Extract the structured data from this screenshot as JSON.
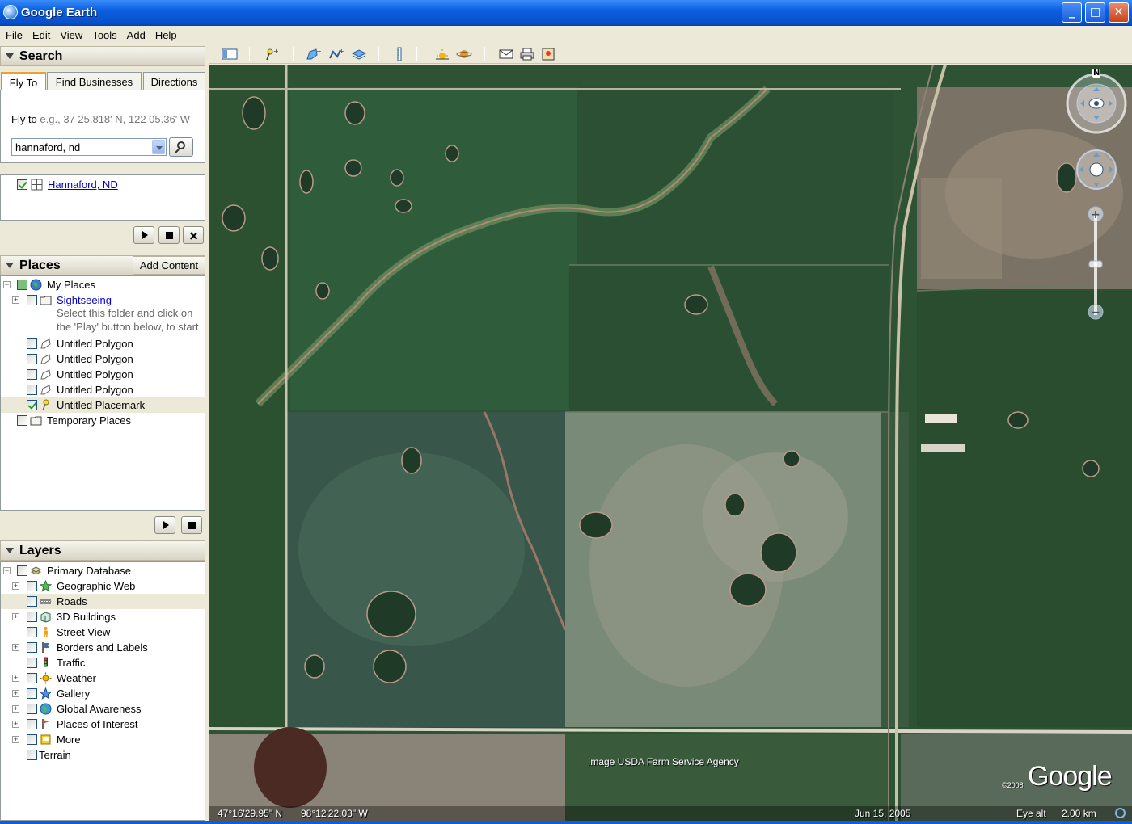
{
  "window": {
    "title": "Google Earth",
    "min": "_",
    "max": "□",
    "close": "✕"
  },
  "menu": [
    "File",
    "Edit",
    "View",
    "Tools",
    "Add",
    "Help"
  ],
  "search": {
    "header": "Search",
    "tabs": [
      "Fly To",
      "Find Businesses",
      "Directions"
    ],
    "fly_label": "Fly to",
    "fly_hint": "e.g., 37 25.818' N, 122 05.36' W",
    "query": "hannaford, nd",
    "result": "Hannaford, ND"
  },
  "places": {
    "header": "Places",
    "add_content": "Add Content",
    "items": [
      {
        "label": "My Places"
      },
      {
        "label": "Sightseeing"
      },
      {
        "label": "Select this folder and click on"
      },
      {
        "label": "the 'Play' button below, to start"
      },
      {
        "label": "Untitled Polygon"
      },
      {
        "label": "Untitled Polygon"
      },
      {
        "label": "Untitled Polygon"
      },
      {
        "label": "Untitled Polygon"
      },
      {
        "label": "Untitled Placemark"
      },
      {
        "label": "Temporary Places"
      }
    ]
  },
  "layers": {
    "header": "Layers",
    "items": [
      {
        "label": "Primary Database"
      },
      {
        "label": "Geographic Web"
      },
      {
        "label": "Roads"
      },
      {
        "label": "3D Buildings"
      },
      {
        "label": "Street View"
      },
      {
        "label": "Borders and Labels"
      },
      {
        "label": "Traffic"
      },
      {
        "label": "Weather"
      },
      {
        "label": "Gallery"
      },
      {
        "label": "Global Awareness"
      },
      {
        "label": "Places of Interest"
      },
      {
        "label": "More"
      },
      {
        "label": "Terrain"
      }
    ]
  },
  "map": {
    "credit": "Image USDA Farm Service Agency",
    "copyright": "©2008",
    "logo": "Google",
    "lat": "47°16'29.95\" N",
    "lon": "98°12'22.03\" W",
    "date": "Jun 15, 2005",
    "eye_alt_label": "Eye alt",
    "eye_alt": "2.00 km",
    "compass_n": "N"
  }
}
